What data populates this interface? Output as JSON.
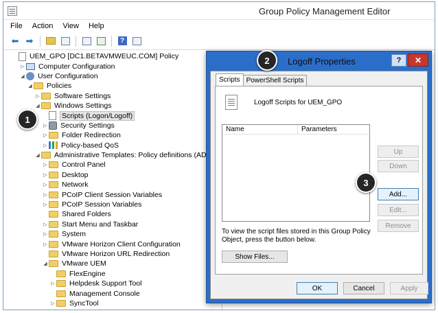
{
  "window": {
    "title": "Group Policy Management Editor"
  },
  "menu": [
    "File",
    "Action",
    "View",
    "Help"
  ],
  "tree": [
    {
      "label": "UEM_GPO [DC1.BETAVMWEUC.COM] Policy",
      "indent": 0,
      "expander": "",
      "icon": "doc"
    },
    {
      "label": "Computer Configuration",
      "indent": 1,
      "expander": "▷",
      "icon": "pc"
    },
    {
      "label": "User Configuration",
      "indent": 1,
      "expander": "◢",
      "icon": "user"
    },
    {
      "label": "Policies",
      "indent": 2,
      "expander": "◢",
      "icon": "folder"
    },
    {
      "label": "Software Settings",
      "indent": 3,
      "expander": "▷",
      "icon": "folder"
    },
    {
      "label": "Windows Settings",
      "indent": 3,
      "expander": "◢",
      "icon": "folder"
    },
    {
      "label": "Scripts (Logon/Logoff)",
      "indent": 4,
      "expander": "",
      "icon": "doc",
      "selected": true
    },
    {
      "label": "Security Settings",
      "indent": 4,
      "expander": "▷",
      "icon": "gear"
    },
    {
      "label": "Folder Redirection",
      "indent": 4,
      "expander": "▷",
      "icon": "folder"
    },
    {
      "label": "Policy-based QoS",
      "indent": 4,
      "expander": "▷",
      "icon": "bars"
    },
    {
      "label": "Administrative Templates: Policy definitions (ADMX f",
      "indent": 3,
      "expander": "◢",
      "icon": "folder"
    },
    {
      "label": "Control Panel",
      "indent": 4,
      "expander": "▷",
      "icon": "folder"
    },
    {
      "label": "Desktop",
      "indent": 4,
      "expander": "▷",
      "icon": "folder"
    },
    {
      "label": "Network",
      "indent": 4,
      "expander": "▷",
      "icon": "folder"
    },
    {
      "label": "PCoIP Client Session Variables",
      "indent": 4,
      "expander": "▷",
      "icon": "folder"
    },
    {
      "label": "PCoIP Session Variables",
      "indent": 4,
      "expander": "▷",
      "icon": "folder"
    },
    {
      "label": "Shared Folders",
      "indent": 4,
      "expander": "",
      "icon": "folder"
    },
    {
      "label": "Start Menu and Taskbar",
      "indent": 4,
      "expander": "▷",
      "icon": "folder"
    },
    {
      "label": "System",
      "indent": 4,
      "expander": "▷",
      "icon": "folder"
    },
    {
      "label": "VMware Horizon Client Configuration",
      "indent": 4,
      "expander": "▷",
      "icon": "folder"
    },
    {
      "label": "VMware Horizon URL Redirection",
      "indent": 4,
      "expander": "",
      "icon": "folder"
    },
    {
      "label": "VMware UEM",
      "indent": 4,
      "expander": "◢",
      "icon": "folder"
    },
    {
      "label": "FlexEngine",
      "indent": 5,
      "expander": "",
      "icon": "folder"
    },
    {
      "label": "Helpdesk Support Tool",
      "indent": 5,
      "expander": "▷",
      "icon": "folder"
    },
    {
      "label": "Management Console",
      "indent": 5,
      "expander": "",
      "icon": "folder"
    },
    {
      "label": "SyncTool",
      "indent": 5,
      "expander": "▷",
      "icon": "folder"
    }
  ],
  "dialog": {
    "title": "Logoff Properties",
    "help_label": "?",
    "close_label": "✕",
    "tabs": [
      "Scripts",
      "PowerShell Scripts"
    ],
    "heading": "Logoff Scripts for UEM_GPO",
    "columns": [
      "Name",
      "Parameters"
    ],
    "buttons": {
      "up": "Up",
      "down": "Down",
      "add": "Add...",
      "edit": "Edit...",
      "remove": "Remove",
      "show_files": "Show Files...",
      "ok": "OK",
      "cancel": "Cancel",
      "apply": "Apply"
    },
    "info": "To view the script files stored in this Group Policy Object, press the button below."
  },
  "badges": [
    "1",
    "2",
    "3"
  ]
}
